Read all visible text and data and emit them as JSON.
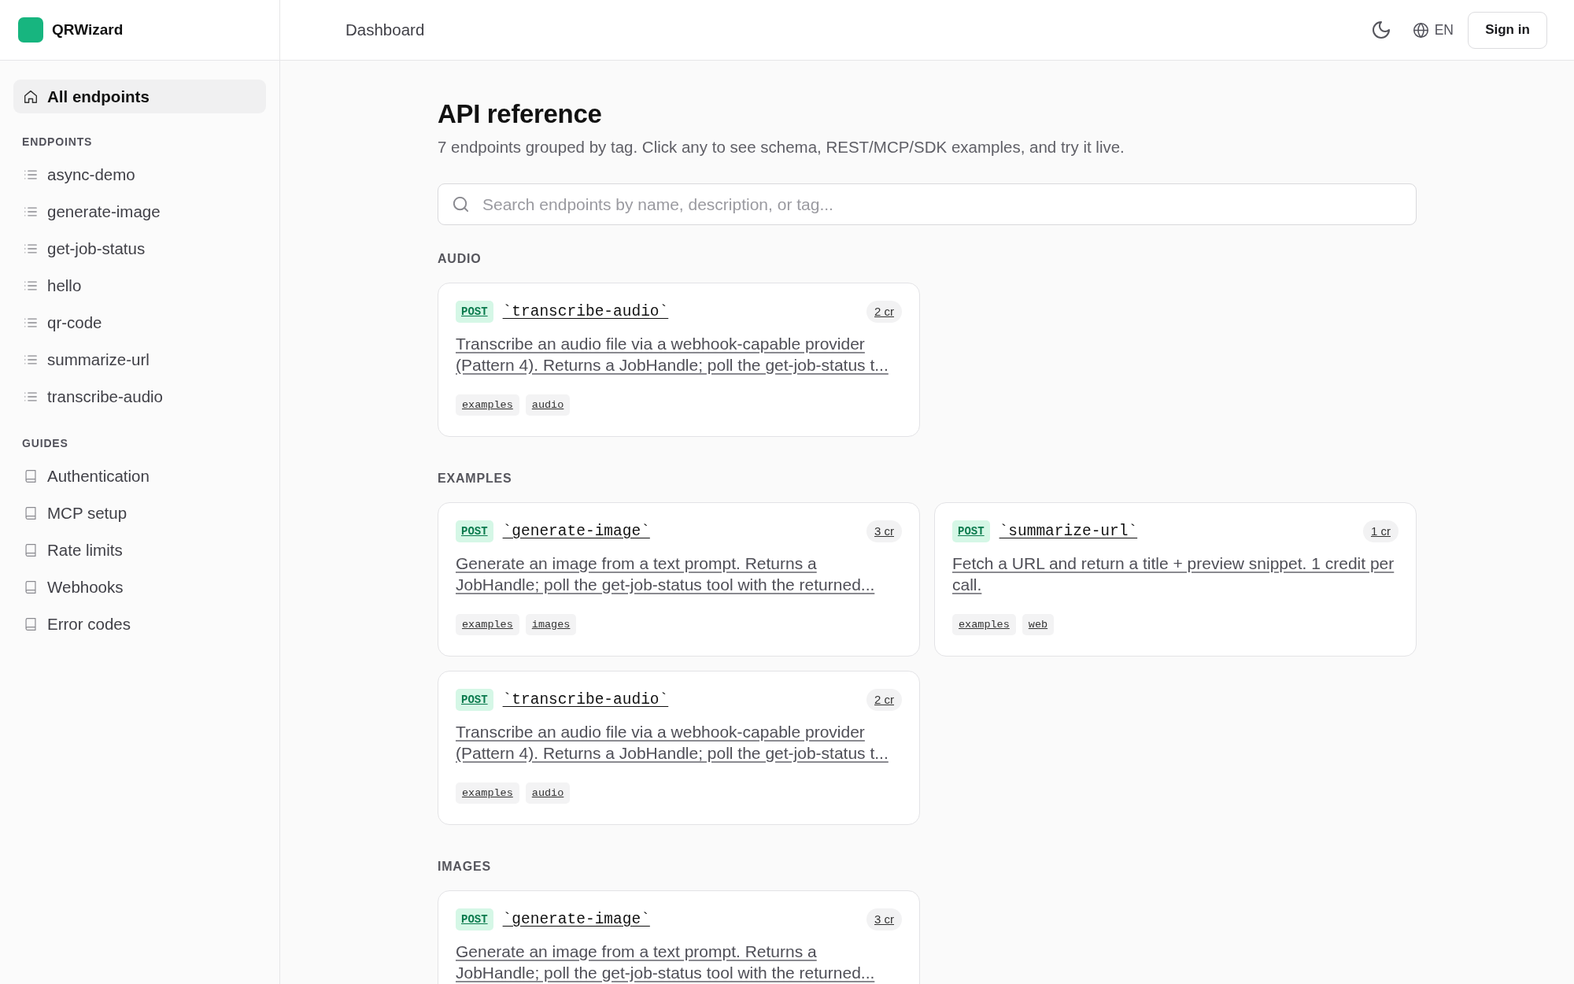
{
  "brand": {
    "name": "QRWizard"
  },
  "header": {
    "breadcrumb": "Dashboard",
    "language": "EN",
    "sign_in": "Sign in"
  },
  "sidebar": {
    "home": {
      "label": "All endpoints",
      "selected": true
    },
    "sections": [
      {
        "heading": "ENDPOINTS",
        "kind": "endpoints",
        "items": [
          {
            "label": "async-demo",
            "selected": false
          },
          {
            "label": "generate-image",
            "selected": false
          },
          {
            "label": "get-job-status",
            "selected": false
          },
          {
            "label": "hello",
            "selected": false
          },
          {
            "label": "qr-code",
            "selected": false
          },
          {
            "label": "summarize-url",
            "selected": false
          },
          {
            "label": "transcribe-audio",
            "selected": false
          }
        ]
      },
      {
        "heading": "GUIDES",
        "kind": "guides",
        "items": [
          {
            "label": "Authentication",
            "selected": false
          },
          {
            "label": "MCP setup",
            "selected": false
          },
          {
            "label": "Rate limits",
            "selected": false
          },
          {
            "label": "Webhooks",
            "selected": false
          },
          {
            "label": "Error codes",
            "selected": false
          }
        ]
      }
    ]
  },
  "page": {
    "title": "API reference",
    "subtitle": "7 endpoints grouped by tag. Click any to see schema, REST/MCP/SDK examples, and try it live.",
    "search": {
      "placeholder": "Search endpoints by name, description, or tag..."
    }
  },
  "groups": [
    {
      "heading": "AUDIO",
      "cards": [
        {
          "method": "POST",
          "name": "`transcribe-audio`",
          "credits": "2 cr",
          "description": "Transcribe an audio file via a webhook-capable provider (Pattern 4). Returns a JobHandle; poll the get-job-status t...",
          "tags": [
            "examples",
            "audio"
          ]
        }
      ]
    },
    {
      "heading": "EXAMPLES",
      "cards": [
        {
          "method": "POST",
          "name": "`generate-image`",
          "credits": "3 cr",
          "description": "Generate an image from a text prompt. Returns a JobHandle; poll the get-job-status tool with the returned...",
          "tags": [
            "examples",
            "images"
          ]
        },
        {
          "method": "POST",
          "name": "`summarize-url`",
          "credits": "1 cr",
          "description": "Fetch a URL and return a title + preview snippet. 1 credit per call.",
          "tags": [
            "examples",
            "web"
          ]
        },
        {
          "method": "POST",
          "name": "`transcribe-audio`",
          "credits": "2 cr",
          "description": "Transcribe an audio file via a webhook-capable provider (Pattern 4). Returns a JobHandle; poll the get-job-status t...",
          "tags": [
            "examples",
            "audio"
          ]
        }
      ]
    },
    {
      "heading": "IMAGES",
      "cards": [
        {
          "method": "POST",
          "name": "`generate-image`",
          "credits": "3 cr",
          "description": "Generate an image from a text prompt. Returns a JobHandle; poll the get-job-status tool with the returned..."
        }
      ]
    }
  ]
}
